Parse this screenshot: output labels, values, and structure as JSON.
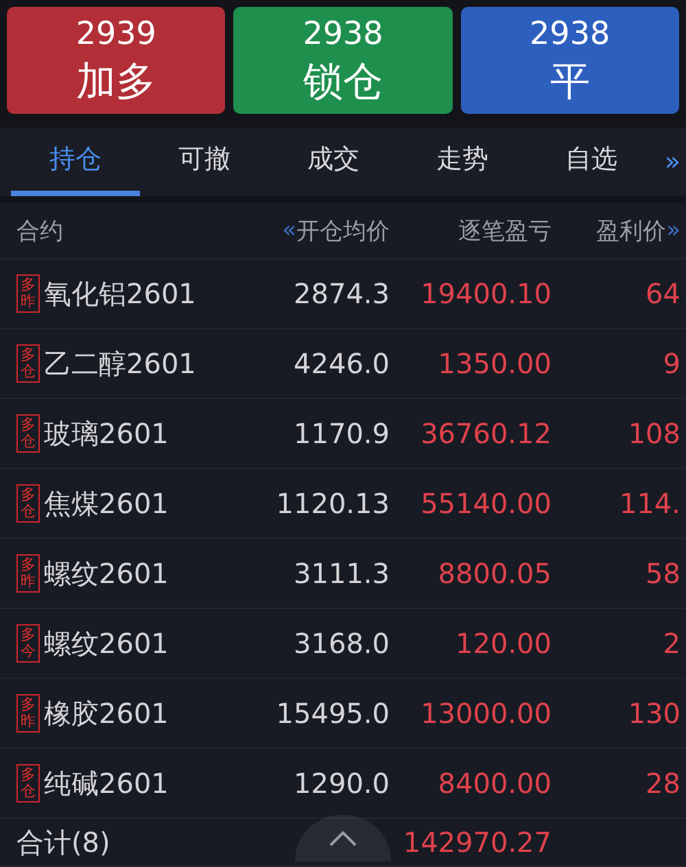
{
  "actions": [
    {
      "price": "2939",
      "label": "加多",
      "kind": "buy"
    },
    {
      "price": "2938",
      "label": "锁仓",
      "kind": "lock"
    },
    {
      "price": "2938",
      "label": "平",
      "kind": "close"
    }
  ],
  "tabs": [
    {
      "label": "持仓",
      "selected": true
    },
    {
      "label": "可撤",
      "selected": false
    },
    {
      "label": "成交",
      "selected": false
    },
    {
      "label": "走势",
      "selected": false
    },
    {
      "label": "自选",
      "selected": false
    }
  ],
  "tabs_more": "»",
  "table": {
    "columns": [
      "合约",
      "开仓均价",
      "逐笔盈亏",
      "盈利价"
    ],
    "scroll_left": "«",
    "scroll_right": "»",
    "rows": [
      {
        "tag": "多昨",
        "contract": "氧化铝2601",
        "avg_price": "2874.3",
        "pnl": "19400.10",
        "column_4": "64"
      },
      {
        "tag": "多仓",
        "contract": "乙二醇2601",
        "avg_price": "4246.0",
        "pnl": "1350.00",
        "column_4": "9"
      },
      {
        "tag": "多仓",
        "contract": "玻璃2601",
        "avg_price": "1170.9",
        "pnl": "36760.12",
        "column_4": "108"
      },
      {
        "tag": "多仓",
        "contract": "焦煤2601",
        "avg_price": "1120.13",
        "pnl": "55140.00",
        "column_4": "114."
      },
      {
        "tag": "多昨",
        "contract": "螺纹2601",
        "avg_price": "3111.3",
        "pnl": "8800.05",
        "column_4": "58"
      },
      {
        "tag": "多今",
        "contract": "螺纹2601",
        "avg_price": "3168.0",
        "pnl": "120.00",
        "column_4": "2"
      },
      {
        "tag": "多昨",
        "contract": "橡胶2601",
        "avg_price": "15495.0",
        "pnl": "13000.00",
        "column_4": "130"
      },
      {
        "tag": "多仓",
        "contract": "纯碱2601",
        "avg_price": "1290.0",
        "pnl": "8400.00",
        "column_4": "28"
      }
    ],
    "total": {
      "label": "合计(8)",
      "pnl": "142970.27"
    }
  }
}
